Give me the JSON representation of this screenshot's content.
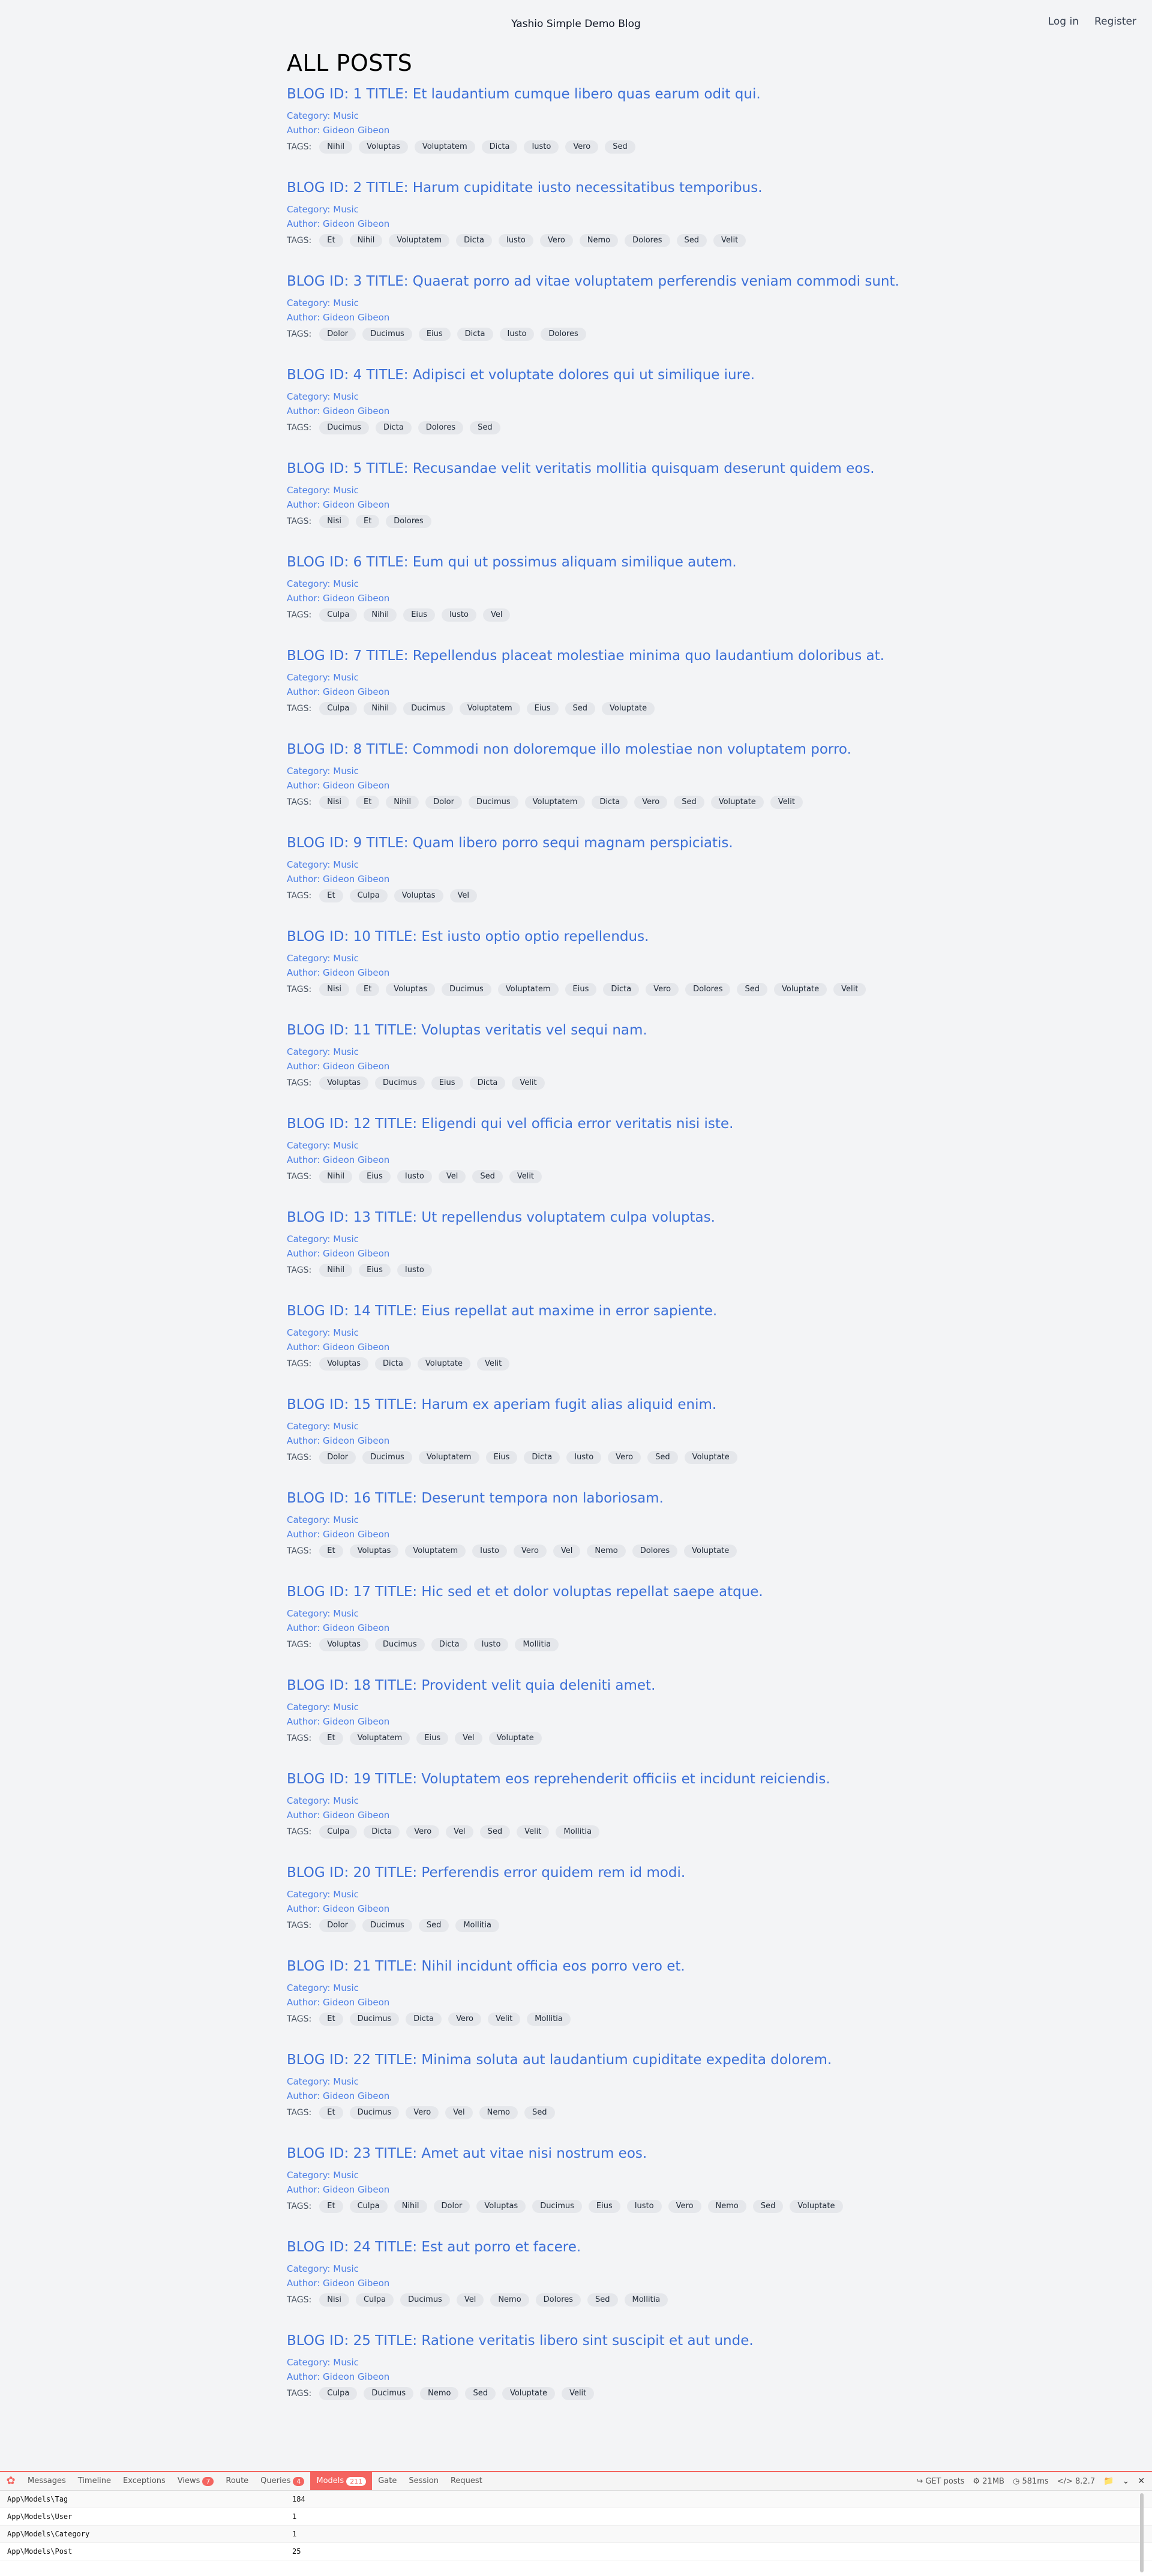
{
  "header": {
    "site_title": "Yashio Simple Demo Blog",
    "login": "Log in",
    "register": "Register"
  },
  "page_title": "ALL POSTS",
  "tags_label": "TAGS:",
  "posts": [
    {
      "title": "BLOG ID: 1 TITLE: Et laudantium cumque libero quas earum odit qui.",
      "category": "Category: Music",
      "author": "Author: Gideon Gibeon",
      "tags": [
        "Nihil",
        "Voluptas",
        "Voluptatem",
        "Dicta",
        "Iusto",
        "Vero",
        "Sed"
      ]
    },
    {
      "title": "BLOG ID: 2 TITLE: Harum cupiditate iusto necessitatibus temporibus.",
      "category": "Category: Music",
      "author": "Author: Gideon Gibeon",
      "tags": [
        "Et",
        "Nihil",
        "Voluptatem",
        "Dicta",
        "Iusto",
        "Vero",
        "Nemo",
        "Dolores",
        "Sed",
        "Velit"
      ]
    },
    {
      "title": "BLOG ID: 3 TITLE: Quaerat porro ad vitae voluptatem perferendis veniam commodi sunt.",
      "category": "Category: Music",
      "author": "Author: Gideon Gibeon",
      "tags": [
        "Dolor",
        "Ducimus",
        "Eius",
        "Dicta",
        "Iusto",
        "Dolores"
      ]
    },
    {
      "title": "BLOG ID: 4 TITLE: Adipisci et voluptate dolores qui ut similique iure.",
      "category": "Category: Music",
      "author": "Author: Gideon Gibeon",
      "tags": [
        "Ducimus",
        "Dicta",
        "Dolores",
        "Sed"
      ]
    },
    {
      "title": "BLOG ID: 5 TITLE: Recusandae velit veritatis mollitia quisquam deserunt quidem eos.",
      "category": "Category: Music",
      "author": "Author: Gideon Gibeon",
      "tags": [
        "Nisi",
        "Et",
        "Dolores"
      ]
    },
    {
      "title": "BLOG ID: 6 TITLE: Eum qui ut possimus aliquam similique autem.",
      "category": "Category: Music",
      "author": "Author: Gideon Gibeon",
      "tags": [
        "Culpa",
        "Nihil",
        "Eius",
        "Iusto",
        "Vel"
      ]
    },
    {
      "title": "BLOG ID: 7 TITLE: Repellendus placeat molestiae minima quo laudantium doloribus at.",
      "category": "Category: Music",
      "author": "Author: Gideon Gibeon",
      "tags": [
        "Culpa",
        "Nihil",
        "Ducimus",
        "Voluptatem",
        "Eius",
        "Sed",
        "Voluptate"
      ]
    },
    {
      "title": "BLOG ID: 8 TITLE: Commodi non doloremque illo molestiae non voluptatem porro.",
      "category": "Category: Music",
      "author": "Author: Gideon Gibeon",
      "tags": [
        "Nisi",
        "Et",
        "Nihil",
        "Dolor",
        "Ducimus",
        "Voluptatem",
        "Dicta",
        "Vero",
        "Sed",
        "Voluptate",
        "Velit"
      ]
    },
    {
      "title": "BLOG ID: 9 TITLE: Quam libero porro sequi magnam perspiciatis.",
      "category": "Category: Music",
      "author": "Author: Gideon Gibeon",
      "tags": [
        "Et",
        "Culpa",
        "Voluptas",
        "Vel"
      ]
    },
    {
      "title": "BLOG ID: 10 TITLE: Est iusto optio optio repellendus.",
      "category": "Category: Music",
      "author": "Author: Gideon Gibeon",
      "tags": [
        "Nisi",
        "Et",
        "Voluptas",
        "Ducimus",
        "Voluptatem",
        "Eius",
        "Dicta",
        "Vero",
        "Dolores",
        "Sed",
        "Voluptate",
        "Velit"
      ]
    },
    {
      "title": "BLOG ID: 11 TITLE: Voluptas veritatis vel sequi nam.",
      "category": "Category: Music",
      "author": "Author: Gideon Gibeon",
      "tags": [
        "Voluptas",
        "Ducimus",
        "Eius",
        "Dicta",
        "Velit"
      ]
    },
    {
      "title": "BLOG ID: 12 TITLE: Eligendi qui vel officia error veritatis nisi iste.",
      "category": "Category: Music",
      "author": "Author: Gideon Gibeon",
      "tags": [
        "Nihil",
        "Eius",
        "Iusto",
        "Vel",
        "Sed",
        "Velit"
      ]
    },
    {
      "title": "BLOG ID: 13 TITLE: Ut repellendus voluptatem culpa voluptas.",
      "category": "Category: Music",
      "author": "Author: Gideon Gibeon",
      "tags": [
        "Nihil",
        "Eius",
        "Iusto"
      ]
    },
    {
      "title": "BLOG ID: 14 TITLE: Eius repellat aut maxime in error sapiente.",
      "category": "Category: Music",
      "author": "Author: Gideon Gibeon",
      "tags": [
        "Voluptas",
        "Dicta",
        "Voluptate",
        "Velit"
      ]
    },
    {
      "title": "BLOG ID: 15 TITLE: Harum ex aperiam fugit alias aliquid enim.",
      "category": "Category: Music",
      "author": "Author: Gideon Gibeon",
      "tags": [
        "Dolor",
        "Ducimus",
        "Voluptatem",
        "Eius",
        "Dicta",
        "Iusto",
        "Vero",
        "Sed",
        "Voluptate"
      ]
    },
    {
      "title": "BLOG ID: 16 TITLE: Deserunt tempora non laboriosam.",
      "category": "Category: Music",
      "author": "Author: Gideon Gibeon",
      "tags": [
        "Et",
        "Voluptas",
        "Voluptatem",
        "Iusto",
        "Vero",
        "Vel",
        "Nemo",
        "Dolores",
        "Voluptate"
      ]
    },
    {
      "title": "BLOG ID: 17 TITLE: Hic sed et et dolor voluptas repellat saepe atque.",
      "category": "Category: Music",
      "author": "Author: Gideon Gibeon",
      "tags": [
        "Voluptas",
        "Ducimus",
        "Dicta",
        "Iusto",
        "Mollitia"
      ]
    },
    {
      "title": "BLOG ID: 18 TITLE: Provident velit quia deleniti amet.",
      "category": "Category: Music",
      "author": "Author: Gideon Gibeon",
      "tags": [
        "Et",
        "Voluptatem",
        "Eius",
        "Vel",
        "Voluptate"
      ]
    },
    {
      "title": "BLOG ID: 19 TITLE: Voluptatem eos reprehenderit officiis et incidunt reiciendis.",
      "category": "Category: Music",
      "author": "Author: Gideon Gibeon",
      "tags": [
        "Culpa",
        "Dicta",
        "Vero",
        "Vel",
        "Sed",
        "Velit",
        "Mollitia"
      ]
    },
    {
      "title": "BLOG ID: 20 TITLE: Perferendis error quidem rem id modi.",
      "category": "Category: Music",
      "author": "Author: Gideon Gibeon",
      "tags": [
        "Dolor",
        "Ducimus",
        "Sed",
        "Mollitia"
      ]
    },
    {
      "title": "BLOG ID: 21 TITLE: Nihil incidunt officia eos porro vero et.",
      "category": "Category: Music",
      "author": "Author: Gideon Gibeon",
      "tags": [
        "Et",
        "Ducimus",
        "Dicta",
        "Vero",
        "Velit",
        "Mollitia"
      ]
    },
    {
      "title": "BLOG ID: 22 TITLE: Minima soluta aut laudantium cupiditate expedita dolorem.",
      "category": "Category: Music",
      "author": "Author: Gideon Gibeon",
      "tags": [
        "Et",
        "Ducimus",
        "Vero",
        "Vel",
        "Nemo",
        "Sed"
      ]
    },
    {
      "title": "BLOG ID: 23 TITLE: Amet aut vitae nisi nostrum eos.",
      "category": "Category: Music",
      "author": "Author: Gideon Gibeon",
      "tags": [
        "Et",
        "Culpa",
        "Nihil",
        "Dolor",
        "Voluptas",
        "Ducimus",
        "Eius",
        "Iusto",
        "Vero",
        "Nemo",
        "Sed",
        "Voluptate"
      ]
    },
    {
      "title": "BLOG ID: 24 TITLE: Est aut porro et facere.",
      "category": "Category: Music",
      "author": "Author: Gideon Gibeon",
      "tags": [
        "Nisi",
        "Culpa",
        "Ducimus",
        "Vel",
        "Nemo",
        "Dolores",
        "Sed",
        "Mollitia"
      ]
    },
    {
      "title": "BLOG ID: 25 TITLE: Ratione veritatis libero sint suscipit et aut unde.",
      "category": "Category: Music",
      "author": "Author: Gideon Gibeon",
      "tags": [
        "Culpa",
        "Ducimus",
        "Nemo",
        "Sed",
        "Voluptate",
        "Velit"
      ]
    }
  ],
  "debugbar": {
    "accent": "#f4645f",
    "tabs": [
      {
        "label": "Messages",
        "badge": ""
      },
      {
        "label": "Timeline",
        "badge": ""
      },
      {
        "label": "Exceptions",
        "badge": ""
      },
      {
        "label": "Views",
        "badge": "7"
      },
      {
        "label": "Route",
        "badge": ""
      },
      {
        "label": "Queries",
        "badge": "4"
      },
      {
        "label": "Models",
        "badge": "211",
        "active": true
      },
      {
        "label": "Gate",
        "badge": ""
      },
      {
        "label": "Session",
        "badge": ""
      },
      {
        "label": "Request",
        "badge": ""
      }
    ],
    "request": "GET posts",
    "memory": "21MB",
    "time": "581ms",
    "version": "8.2.7",
    "rows": [
      {
        "model": "App\\Models\\Tag",
        "count": "184"
      },
      {
        "model": "App\\Models\\User",
        "count": "1"
      },
      {
        "model": "App\\Models\\Category",
        "count": "1"
      },
      {
        "model": "App\\Models\\Post",
        "count": "25"
      }
    ]
  }
}
